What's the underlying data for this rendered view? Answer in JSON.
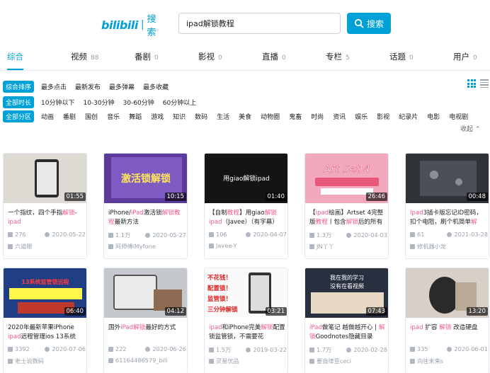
{
  "header": {
    "logo_brand": "bilibili",
    "logo_sep": "|",
    "logo_text": "搜索",
    "search_value": "ipad解锁教程",
    "search_button": "搜索"
  },
  "tabs": [
    {
      "label": "综合",
      "count": ""
    },
    {
      "label": "视频",
      "count": "88"
    },
    {
      "label": "番剧",
      "count": "0"
    },
    {
      "label": "影视",
      "count": "0"
    },
    {
      "label": "直播",
      "count": "0"
    },
    {
      "label": "专栏",
      "count": "5"
    },
    {
      "label": "话题",
      "count": "0"
    },
    {
      "label": "用户",
      "count": "0"
    }
  ],
  "filters": {
    "sort": {
      "active": "综合排序",
      "options": [
        "最多点击",
        "最新发布",
        "最多弹幕",
        "最多收藏"
      ]
    },
    "duration": {
      "active": "全部时长",
      "options": [
        "10分钟以下",
        "10-30分钟",
        "30-60分钟",
        "60分钟以上"
      ]
    },
    "zone": {
      "active": "全部分区",
      "options": [
        "动画",
        "番剧",
        "国创",
        "音乐",
        "舞蹈",
        "游戏",
        "知识",
        "数码",
        "生活",
        "美食",
        "动物圈",
        "鬼畜",
        "时尚",
        "资讯",
        "娱乐",
        "影视",
        "纪录片",
        "电影",
        "电视剧"
      ]
    },
    "collapse": "收起"
  },
  "videos": [
    {
      "duration": "01:55",
      "title": [
        {
          "t": "一个指纹，四个手指"
        },
        {
          "t": "解锁",
          "h": 1
        },
        {
          "t": "-"
        },
        {
          "t": "ipad",
          "h": 1
        }
      ],
      "views": "276",
      "date": "2020-05-22",
      "uploader": "六道眼"
    },
    {
      "duration": "10:15",
      "title": [
        {
          "t": "iPhone/"
        },
        {
          "t": "iPad",
          "h": 1
        },
        {
          "t": "激活锁"
        },
        {
          "t": "解锁",
          "h": 1
        },
        {
          "t": "教程",
          "h": 1
        },
        {
          "t": "最新方法"
        }
      ],
      "views": "1.1万",
      "date": "2020-05-27",
      "uploader": "阿师傅iMyfone"
    },
    {
      "duration": "01:40",
      "title": [
        {
          "t": "【自制"
        },
        {
          "t": "教程",
          "h": 1
        },
        {
          "t": "】用giao"
        },
        {
          "t": "解锁",
          "h": 1
        },
        {
          "t": "ipad",
          "h": 1
        },
        {
          "t": "（Javee）（有字幕）"
        }
      ],
      "views": "106",
      "date": "2020-04-07",
      "uploader": "Javee-Y"
    },
    {
      "duration": "26:46",
      "title": [
        {
          "t": "【"
        },
        {
          "t": "ipad",
          "h": 1
        },
        {
          "t": "绘画】Artset 4完整版"
        },
        {
          "t": "教程",
          "h": 1
        },
        {
          "t": "丨包含"
        },
        {
          "t": "解锁",
          "h": 1
        },
        {
          "t": "后的所有"
        }
      ],
      "views": "1.3万",
      "date": "2020-04-03",
      "uploader": "JN丫丫"
    },
    {
      "duration": "00:48",
      "title": [
        {
          "t": "ipad",
          "h": 1
        },
        {
          "t": "3插卡版忘记ID密码，扣个电阻，刷个机简单"
        },
        {
          "t": "解",
          "h": 1
        }
      ],
      "views": "61",
      "date": "2021-03-28",
      "uploader": "修机器小龙"
    },
    {
      "duration": "06:40",
      "title": [
        {
          "t": "2020年最新苹果iPhone "
        },
        {
          "t": "ipad",
          "h": 1
        },
        {
          "t": "远程管理ios 13系统"
        }
      ],
      "views": "3392",
      "date": "2020-07-06",
      "uploader": "老土说数码"
    },
    {
      "duration": "04:12",
      "title": [
        {
          "t": "国外"
        },
        {
          "t": "iPad",
          "h": 1
        },
        {
          "t": "解锁",
          "h": 1
        },
        {
          "t": "最好的方式"
        }
      ],
      "views": "222",
      "date": "2020-06-26",
      "uploader": "61164486579_bili"
    },
    {
      "duration": "03:21",
      "title": [
        {
          "t": "ipad",
          "h": 1
        },
        {
          "t": "和iPhone完美"
        },
        {
          "t": "解锁",
          "h": 1
        },
        {
          "t": "配置锁监管锁，不需要花"
        }
      ],
      "views": "1.5万",
      "date": "2019-03-22",
      "uploader": "灵易优品"
    },
    {
      "duration": "07:43",
      "title": [
        {
          "t": "iPad",
          "h": 1
        },
        {
          "t": "做笔记 越做越开心 | "
        },
        {
          "t": "解锁",
          "h": 1
        },
        {
          "t": "Goodnotes隐藏目录"
        }
      ],
      "views": "1.7万",
      "date": "2020-02-28",
      "uploader": "要自律豆ceci"
    },
    {
      "duration": "13:20",
      "title": [
        {
          "t": "ipad",
          "h": 1
        },
        {
          "t": " 扩容 "
        },
        {
          "t": "解锁",
          "h": 1
        },
        {
          "t": " 改造硬盘"
        }
      ],
      "views": "335",
      "date": "2020-06-01",
      "uploader": "向往未来s"
    }
  ],
  "thumbs": [
    {
      "bg": "#d9d7d2",
      "text": ""
    },
    {
      "bg": "#6a4aa8",
      "text": "激活锁解锁"
    },
    {
      "bg": "#1b1b1b",
      "text": "用giao解锁ipad"
    },
    {
      "bg": "#f6b8c8",
      "text": "Art Set 4"
    },
    {
      "bg": "#3a3d42",
      "text": ""
    },
    {
      "bg": "#2a4a8a",
      "text": "13系统监管锁远程"
    },
    {
      "bg": "#c9cbd0",
      "text": ""
    },
    {
      "bg": "#ffffff",
      "text": "不花钱！配置锁！监管锁！三分钟解锁"
    },
    {
      "bg": "#2a2f3a",
      "text": "我在我的学习没有在看视频"
    },
    {
      "bg": "#d6cdc4",
      "text": ""
    }
  ],
  "colors": {
    "accent": "#00a1d6",
    "highlight": "#f25d8e",
    "meta": "#99a2aa"
  }
}
